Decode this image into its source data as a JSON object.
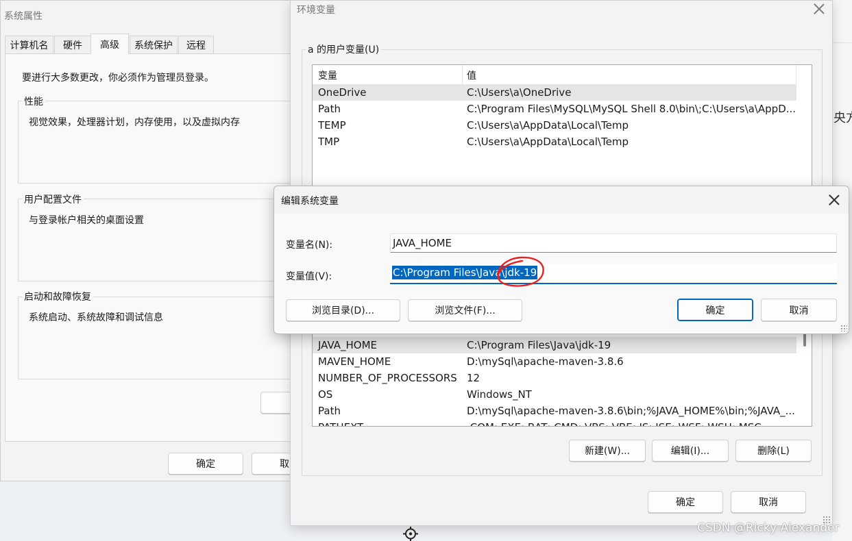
{
  "sysprops": {
    "title": "系统属性",
    "tabs": [
      "计算机名",
      "硬件",
      "高级",
      "系统保护",
      "远程"
    ],
    "active_tab": "高级",
    "admin_note": "要进行大多数更改，你必须作为管理员登录。",
    "groups": [
      {
        "title": "性能",
        "desc": "视觉效果，处理器计划，内存使用，以及虚拟内存"
      },
      {
        "title": "用户配置文件",
        "desc": "与登录帐户相关的桌面设置"
      },
      {
        "title": "启动和故障恢复",
        "desc": "系统启动、系统故障和调试信息"
      }
    ],
    "ok_label": "确定",
    "cancel_label_partial": "取"
  },
  "envvars": {
    "title": "环境变量",
    "user_group_title": "a 的用户变量(U)",
    "columns": [
      "变量",
      "值"
    ],
    "user_rows": [
      {
        "name": "OneDrive",
        "value": "C:\\Users\\a\\OneDrive"
      },
      {
        "name": "Path",
        "value": "C:\\Program Files\\MySQL\\MySQL Shell 8.0\\bin\\;C:\\Users\\a\\AppD..."
      },
      {
        "name": "TEMP",
        "value": "C:\\Users\\a\\AppData\\Local\\Temp"
      },
      {
        "name": "TMP",
        "value": "C:\\Users\\a\\AppData\\Local\\Temp"
      }
    ],
    "system_rows": [
      {
        "name": "JAVA_HOME",
        "value": "C:\\Program Files\\Java\\jdk-19"
      },
      {
        "name": "MAVEN_HOME",
        "value": "D:\\mySql\\apache-maven-3.8.6"
      },
      {
        "name": "NUMBER_OF_PROCESSORS",
        "value": "12"
      },
      {
        "name": "OS",
        "value": "Windows_NT"
      },
      {
        "name": "Path",
        "value": "D:\\mySql\\apache-maven-3.8.6\\bin;%JAVA_HOME%\\bin;%JAVA_..."
      },
      {
        "name": "PATHEXT",
        "value": ".COM;.EXE;.BAT;.CMD;.VBS;.VBE;.JS;.JSE;.WSF;.WSH;.MSC"
      }
    ],
    "new_label": "新建(W)...",
    "edit_label": "编辑(I)...",
    "delete_label": "删除(L)",
    "ok_label": "确定",
    "cancel_label": "取消"
  },
  "editdlg": {
    "title": "编辑系统变量",
    "name_label": "变量名(N):",
    "value_label": "变量值(V):",
    "name_value": "JAVA_HOME",
    "value_value": "C:\\Program Files\\Java\\jdk-19",
    "browse_dir_label": "浏览目录(D)...",
    "browse_file_label": "浏览文件(F)...",
    "ok_label": "确定",
    "cancel_label": "取消"
  },
  "background": {
    "edge_text": "央方"
  },
  "watermark": "CSDN @Ricky Alexander",
  "colors": {
    "selection": "#0067c0",
    "annotation": "#e8231f"
  }
}
